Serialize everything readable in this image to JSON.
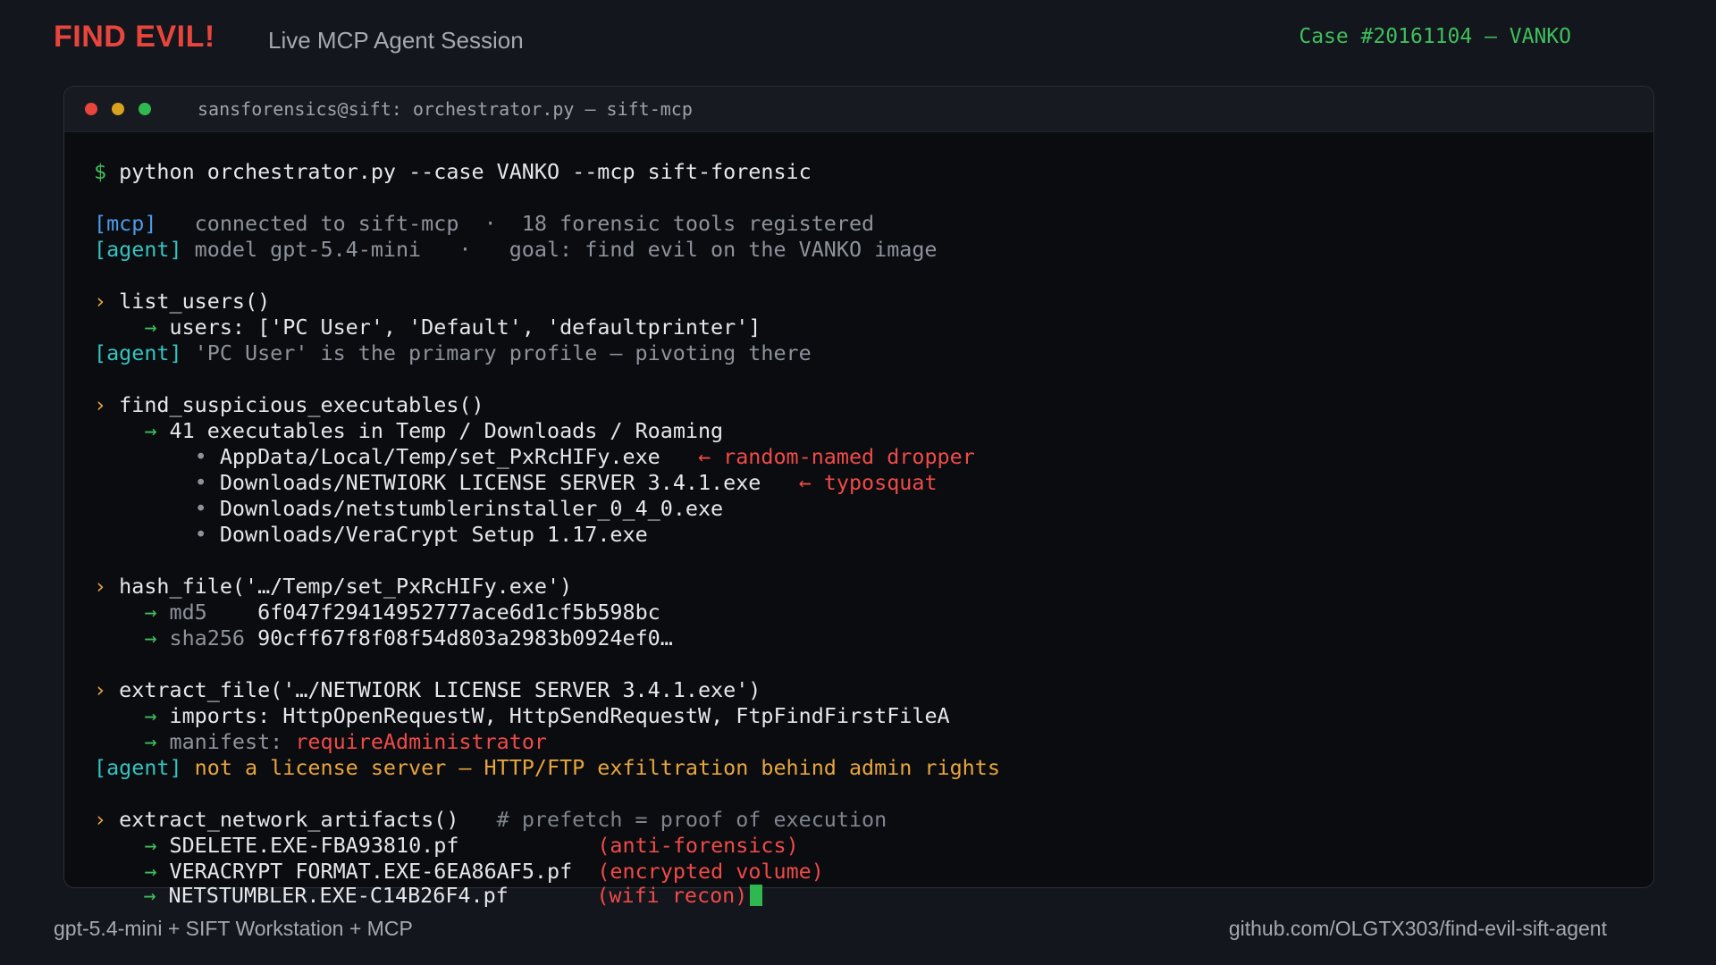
{
  "header": {
    "brand": "FIND EVIL!",
    "subtitle": "Live MCP Agent Session",
    "case": "Case #20161104 — VANKO"
  },
  "terminal": {
    "title": "sansforensics@sift: orchestrator.py — sift-mcp",
    "prompt": "$",
    "command": " python orchestrator.py --case VANKO --mcp sift-forensic",
    "mcp_tag": "[mcp]",
    "mcp_text": "   connected to sift-mcp  ·  18 forensic tools registered",
    "agent_tag": "[agent]",
    "agent_model_text": " model gpt-5.4-mini   ·   goal: find evil on the VANKO image",
    "call_marker": "›",
    "arrow": "→",
    "bullet": "•",
    "list_users": {
      "call": " list_users()",
      "result": " users: ['PC User', 'Default', 'defaultprinter']",
      "agent_note": " 'PC User' is the primary profile — pivoting there"
    },
    "find_suspicious": {
      "call": " find_suspicious_executables()",
      "result": " 41 executables in Temp / Downloads / Roaming",
      "items": [
        {
          "path": " AppData/Local/Temp/set_PxRcHIFy.exe",
          "note": "   ← random-named dropper"
        },
        {
          "path": " Downloads/NETWIORK LICENSE SERVER 3.4.1.exe",
          "note": "   ← typosquat"
        },
        {
          "path": " Downloads/netstumblerinstaller_0_4_0.exe",
          "note": ""
        },
        {
          "path": " Downloads/VeraCrypt Setup 1.17.exe",
          "note": ""
        }
      ]
    },
    "hash_file": {
      "call": " hash_file('…/Temp/set_PxRcHIFy.exe')",
      "md5_label": " md5",
      "md5_value": "    6f047f29414952777ace6d1cf5b598bc",
      "sha_label": " sha256",
      "sha_value": " 90cff67f8f08f54d803a2983b0924ef0…"
    },
    "extract_file": {
      "call": " extract_file('…/NETWIORK LICENSE SERVER 3.4.1.exe')",
      "imports_label": " imports:",
      "imports_value": " HttpOpenRequestW, HttpSendRequestW, FtpFindFirstFileA",
      "manifest_label": " manifest:",
      "manifest_value": " requireAdministrator",
      "agent_note": " not a license server — HTTP/FTP exfiltration behind admin rights"
    },
    "extract_network": {
      "call": " extract_network_artifacts()",
      "comment": "   # prefetch = proof of execution",
      "items": [
        {
          "file": " SDELETE.EXE-FBA93810.pf           ",
          "note": "(anti-forensics)"
        },
        {
          "file": " VERACRYPT FORMAT.EXE-6EA86AF5.pf  ",
          "note": "(encrypted volume)"
        },
        {
          "file": " NETSTUMBLER.EXE-C14B26F4.pf       ",
          "note": "(wifi recon)"
        }
      ]
    }
  },
  "footer": {
    "left": "gpt-5.4-mini  +  SIFT Workstation  +  MCP",
    "right": "github.com/OLGTX303/find-evil-sift-agent"
  }
}
